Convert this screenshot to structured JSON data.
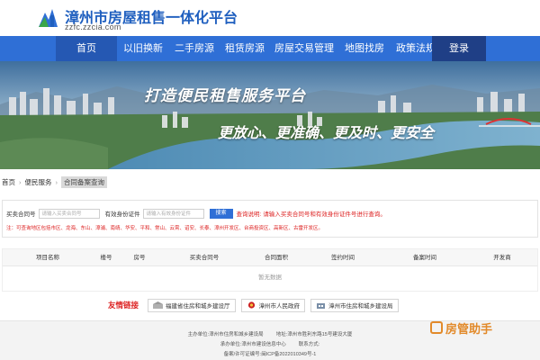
{
  "header": {
    "site_title": "漳州市房屋租售一体化平台",
    "site_url": "zzfc.zzcia.com"
  },
  "nav": {
    "items": [
      "首页",
      "以旧换新",
      "二手房源",
      "租赁房源",
      "房屋交易管理",
      "地图找房",
      "政策法规"
    ],
    "login": "登录"
  },
  "banner": {
    "line1": "打造便民租售服务平台",
    "line2": "更放心、更准确、更及时、更安全"
  },
  "breadcrumb": [
    "首页",
    "便民服务",
    "合同备案查询"
  ],
  "search": {
    "contract_label": "买卖合同号",
    "contract_placeholder": "请输入买卖合同号",
    "id_label": "有效身份证件",
    "id_placeholder": "请输入有效身份证件",
    "search_button": "搜索",
    "tip_label": "查询说明:",
    "tip_text": "请输入买卖合同号和有效身份证件号进行查询。",
    "note": "注：可查询地区包括市区、龙海、东山、漳浦、南靖、华安、平和、常山、云霄、诏安、长泰、漳州开发区、台商投资区、高新区、古雷开发区。"
  },
  "table": {
    "headers": [
      "项目名称",
      "楼号",
      "房号",
      "买卖合同号",
      "合同面积",
      "签约时间",
      "备案时间",
      "开发商"
    ],
    "empty_text": "暂无数据"
  },
  "friend_links": {
    "title": "友情链接",
    "items": [
      "福建省住房和城乡建设厅",
      "漳州市人民政府",
      "漳州市住房和城乡建设局"
    ]
  },
  "footer": {
    "host_label": "主办单位:",
    "host": "漳州市住房和城乡建设局",
    "address_label": "地址:",
    "address": "漳州市胜利东路15号建设大厦",
    "undertaker_label": "承办单位:",
    "undertaker": "漳州市建设信息中心",
    "phone_label": "联系方式:",
    "phone": "",
    "icp_label": "备案/许可证编号:",
    "icp": "闽ICP备2022010349号-1"
  },
  "watermark": "房管助手",
  "colors": {
    "nav_bg": "#2f6fd6",
    "login_bg": "#1f3f86",
    "accent_red": "#d22222",
    "title_blue": "#1f5fbf"
  }
}
